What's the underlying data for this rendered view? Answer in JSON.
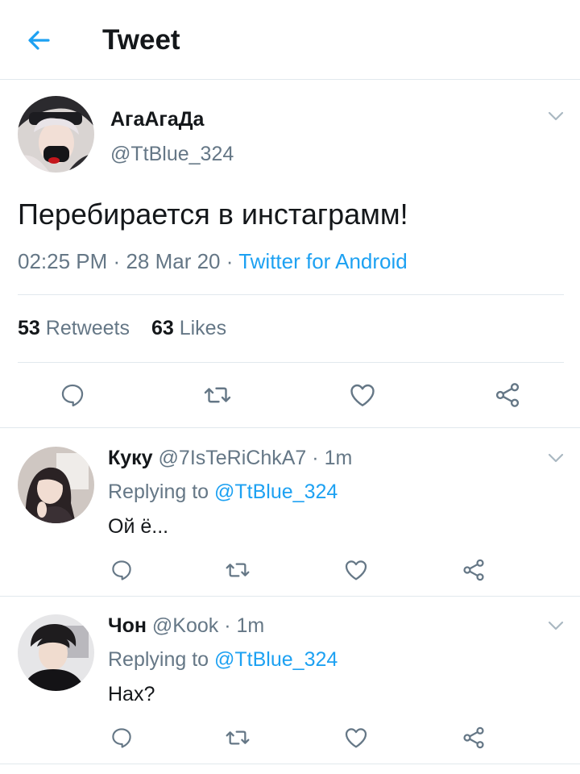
{
  "header": {
    "title": "Tweet"
  },
  "main_tweet": {
    "display_name": "АгаАгаДа",
    "handle": "@TtBlue_324",
    "text": "Перебирается в инстаграмм!",
    "time": "02:25 PM",
    "date": "28 Mar 20",
    "separator": "·",
    "source": "Twitter for Android",
    "retweets_count": "53",
    "retweets_label": "Retweets",
    "likes_count": "63",
    "likes_label": "Likes"
  },
  "replies": [
    {
      "display_name": "Куку",
      "handle": "@7IsTeRiChkA7",
      "separator": "·",
      "time": "1m",
      "replying_prefix": "Replying to",
      "replying_to": "@TtBlue_324",
      "text": "Ой ё..."
    },
    {
      "display_name": "Чон",
      "handle": "@Kook",
      "separator": "·",
      "time": "1m",
      "replying_prefix": "Replying to",
      "replying_to": "@TtBlue_324",
      "text": "Нах?"
    }
  ],
  "colors": {
    "accent": "#1da1f2",
    "text_primary": "#14171a",
    "text_secondary": "#657786",
    "divider": "#e1e8ed"
  },
  "icons": {
    "back": "arrow-left-icon",
    "menu": "chevron-down-icon",
    "reply": "comment-icon",
    "retweet": "retweet-icon",
    "like": "heart-icon",
    "share": "share-icon"
  }
}
